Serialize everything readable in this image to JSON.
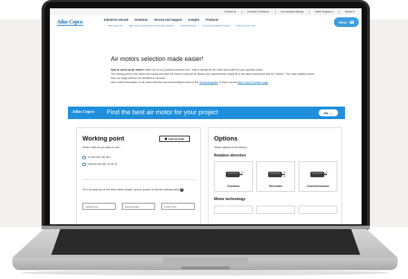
{
  "topbar": {
    "items": [
      "Contact Us",
      "Products & Solutions",
      "Our complete offering",
      "United Kingdom",
      "Search"
    ]
  },
  "header": {
    "logo": "Atlas Copco",
    "nav": [
      "Industries Served",
      "Solutions",
      "Service and Support",
      "Insights",
      "Products"
    ],
    "breadcrumbs": [
      "Atlas Copco UK",
      "Atlas Copco Industrial tools & assembly solutions",
      "Industries Served",
      "Air motors and Electric motors",
      "Select your air motor"
    ],
    "menu_label": "Menu"
  },
  "intro": {
    "title": "Air motors selection made easier!",
    "q_bold": "How to select an air motor?",
    "q_rest": " Make use of our powerful selection tool - built to identify the air motor best suited for your specific needs.",
    "p2": "The working point is the speed and torque you want the motor to operate at. Based your requirements, simply fill in the data boxes below and hit \"Search\". The most suitable motors from our range will then be identified in seconds.",
    "p3_start": "More useful information on air motor selection and functionality is found in the ",
    "link1": "Technical guides",
    "p3_mid": " or check out the ",
    "link2": "Atlas Copco Product range",
    "p3_end": "."
  },
  "banner": {
    "logo": "Atlas Copco",
    "title": "Find the best air motor for your project",
    "lang": "EN"
  },
  "working_point": {
    "title": "Working point",
    "clear_label": "Clear all fields",
    "units_question": "Which units do you want to use?",
    "unit_options": [
      {
        "label": "SI units (bar, kW, Nm)",
        "selected": true
      },
      {
        "label": "Imperial units (psi, hp, lbf, ft)",
        "selected": false
      }
    ],
    "fill_note": "Fill in at least two of the three fields (torque, speed, power) to find the missing value",
    "info_glyph": "i",
    "fields": [
      {
        "placeholder": "Torque (Nm)"
      },
      {
        "placeholder": "Speed (r/min)"
      },
      {
        "placeholder": "Power (Kw)"
      }
    ]
  },
  "options": {
    "title": "Options",
    "subtitle": "Select options for Air Motors",
    "rotation_heading": "Rotation direction",
    "rotation": [
      "Clockwise",
      "Reversible",
      "Counterclockwise"
    ],
    "technology_heading": "Motor technology"
  },
  "colors": {
    "brand_blue": "#0d6eb3",
    "banner_blue": "#1f8fdb",
    "menu_blue": "#3d9ee0"
  }
}
